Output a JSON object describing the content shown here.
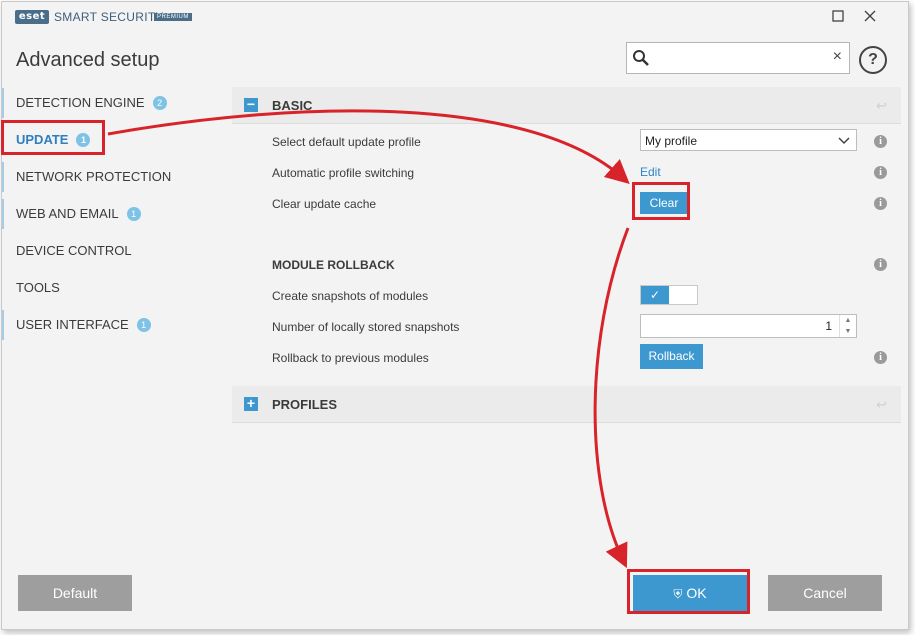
{
  "titlebar": {
    "logo": "eset",
    "app_name": "SMART SECURITY",
    "edition": "PREMIUM",
    "maximize_icon": "square-icon",
    "close_icon": "close-icon"
  },
  "header": {
    "title": "Advanced setup",
    "search_placeholder": "",
    "search_clear": "×",
    "help_label": "?"
  },
  "sidebar": {
    "items": [
      {
        "label": "DETECTION ENGINE",
        "badge": "2"
      },
      {
        "label": "UPDATE",
        "badge": "1",
        "active": true
      },
      {
        "label": "NETWORK PROTECTION",
        "badge": ""
      },
      {
        "label": "WEB AND EMAIL",
        "badge": "1"
      },
      {
        "label": "DEVICE CONTROL",
        "badge": ""
      },
      {
        "label": "TOOLS",
        "badge": ""
      },
      {
        "label": "USER INTERFACE",
        "badge": "1"
      }
    ]
  },
  "basic": {
    "collapse_symbol": "−",
    "title": "BASIC",
    "rows": {
      "profile_label": "Select default update profile",
      "profile_value": "My profile",
      "switching_label": "Automatic profile switching",
      "switching_link": "Edit",
      "cache_label": "Clear update cache",
      "cache_button": "Clear"
    },
    "rollback": {
      "title": "MODULE ROLLBACK",
      "snapshots_label": "Create snapshots of modules",
      "snapshots_enabled": true,
      "count_label": "Number of locally stored snapshots",
      "count_value": "1",
      "rollback_label": "Rollback to previous modules",
      "rollback_button": "Rollback"
    }
  },
  "profiles": {
    "expand_symbol": "+",
    "title": "PROFILES"
  },
  "footer": {
    "default_button": "Default",
    "ok_button": "OK",
    "cancel_button": "Cancel"
  },
  "colors": {
    "accent": "#3d98d0",
    "highlight": "#d9232a",
    "footer_gray": "#9e9e9e"
  }
}
